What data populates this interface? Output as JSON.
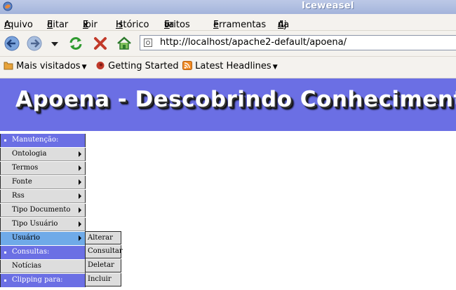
{
  "window": {
    "title": "Iceweasel"
  },
  "menubar": [
    {
      "pre": "",
      "u": "A",
      "post": "rquivo"
    },
    {
      "pre": "",
      "u": "E",
      "post": "ditar"
    },
    {
      "pre": "E",
      "u": "x",
      "post": "ibir"
    },
    {
      "pre": "",
      "u": "H",
      "post": "istórico"
    },
    {
      "pre": "Fa",
      "u": "v",
      "post": "oritos"
    },
    {
      "pre": "",
      "u": "F",
      "post": "erramentas"
    },
    {
      "pre": "Aj",
      "u": "u",
      "post": "da"
    }
  ],
  "address": {
    "url": "http://localhost/apache2-default/apoena/"
  },
  "bookmarks": [
    "Mais visitados",
    "Getting Started",
    "Latest Headlines"
  ],
  "page": {
    "banner_title": "Apoena - Descobrindo Conhecimento"
  },
  "menu": {
    "manutencao": "Manutenção:",
    "ontologia": "Ontologia",
    "termos": "Termos",
    "fonte": "Fonte",
    "rss": "Rss",
    "tipo_documento": "Tipo Documento",
    "tipo_usuario": "Tipo Usuário",
    "usuario": "Usuário",
    "consultas": "Consultas:",
    "noticias": "Notícias",
    "clipping": "Clipping para:"
  },
  "submenu": [
    "Alterar",
    "Consultar",
    "Deletar",
    "Incluir"
  ]
}
